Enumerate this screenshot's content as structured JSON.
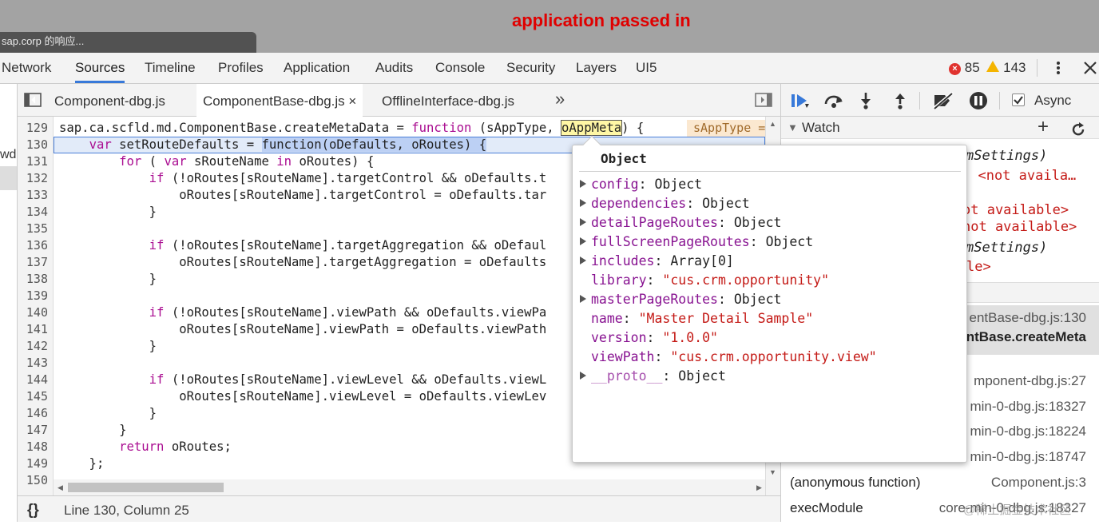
{
  "window": {
    "tab_title": "sap.corp 的响应...",
    "annotation": "application passed in"
  },
  "main_tabs": [
    "Network",
    "Sources",
    "Timeline",
    "Profiles",
    "Application",
    "Audits",
    "Console",
    "Security",
    "Layers",
    "UI5"
  ],
  "main_tab_active": "Sources",
  "counts": {
    "errors": "85",
    "warnings": "143"
  },
  "left_strip_text": "wd",
  "file_tabs": [
    "Component-dbg.js",
    "ComponentBase-dbg.js",
    "OfflineInterface-dbg.js"
  ],
  "file_tab_active": "ComponentBase-dbg.js",
  "more_tabs": "»",
  "code": {
    "line_numbers": [
      "129",
      "130",
      "131",
      "132",
      "133",
      "134",
      "135",
      "136",
      "137",
      "138",
      "139",
      "140",
      "141",
      "142",
      "143",
      "144",
      "145",
      "146",
      "147",
      "148",
      "149",
      "150"
    ],
    "line129": {
      "a": "sap.ca.scfld.md.ComponentBase.createMetaData = ",
      "kw": "function",
      "b": " (sAppType, ",
      "hl": "oAppMeta",
      "c": ") {",
      "hint": "sAppType ="
    },
    "lines": [
      {
        "pre": "    ",
        "kw": "var",
        "post": " setRouteDefaults = "
      },
      {
        "pre": "        ",
        "kw": "for",
        "post": " ( ",
        "kw2": "var",
        "post2": " sRouteName ",
        "kw3": "in",
        "post3": " oRoutes) {"
      },
      {
        "pre": "            ",
        "kw": "if",
        "post": " (!oRoutes[sRouteName].targetControl && oDefaults.t"
      },
      {
        "pre": "                oRoutes[sRouteName].targetControl = oDefaults.tar",
        "kw": "",
        "post": ""
      },
      {
        "pre": "            }",
        "kw": "",
        "post": ""
      },
      {
        "pre": "",
        "kw": "",
        "post": ""
      },
      {
        "pre": "            ",
        "kw": "if",
        "post": " (!oRoutes[sRouteName].targetAggregation && oDefaul"
      },
      {
        "pre": "                oRoutes[sRouteName].targetAggregation = oDefaults",
        "kw": "",
        "post": ""
      },
      {
        "pre": "            }",
        "kw": "",
        "post": ""
      },
      {
        "pre": "",
        "kw": "",
        "post": ""
      },
      {
        "pre": "            ",
        "kw": "if",
        "post": " (!oRoutes[sRouteName].viewPath && oDefaults.viewPa"
      },
      {
        "pre": "                oRoutes[sRouteName].viewPath = oDefaults.viewPath",
        "kw": "",
        "post": ""
      },
      {
        "pre": "            }",
        "kw": "",
        "post": ""
      },
      {
        "pre": "",
        "kw": "",
        "post": ""
      },
      {
        "pre": "            ",
        "kw": "if",
        "post": " (!oRoutes[sRouteName].viewLevel && oDefaults.viewL"
      },
      {
        "pre": "                oRoutes[sRouteName].viewLevel = oDefaults.viewLev",
        "kw": "",
        "post": ""
      },
      {
        "pre": "            }",
        "kw": "",
        "post": ""
      },
      {
        "pre": "        }",
        "kw": "",
        "post": ""
      },
      {
        "pre": "        ",
        "kw": "return",
        "post": " oRoutes;"
      },
      {
        "pre": "    };",
        "kw": "",
        "post": ""
      },
      {
        "pre": "",
        "kw": "",
        "post": ""
      }
    ],
    "line130_fn": "function(oDefaults, oRoutes) {"
  },
  "status_bar": {
    "braces": "{}",
    "position": "Line 130, Column 25"
  },
  "debugger": {
    "async_label": "Async",
    "watch_label": "Watch"
  },
  "right_fragments": [
    {
      "text": "mSettings)",
      "color": "#222",
      "italic": true,
      "mono": true
    },
    {
      "text": "; <not availa…",
      "color": "#c41a16",
      "italic": false,
      "mono": true
    },
    {
      "text": "ot available>",
      "color": "#c41a16",
      "italic": false,
      "mono": true
    },
    {
      "text": "not available>",
      "color": "#c41a16",
      "italic": false,
      "mono": true
    },
    {
      "text": "mSettings)",
      "color": "#222",
      "italic": true,
      "mono": true
    },
    {
      "text": "le>",
      "color": "#c41a16",
      "italic": false,
      "mono": true
    }
  ],
  "call_stack": [
    {
      "name": "",
      "file": "entBase-dbg.js:130"
    },
    {
      "name": "",
      "file": "ntBase.createMeta"
    },
    {
      "name": "",
      "file": "mponent-dbg.js:27"
    },
    {
      "name": "",
      "file": "min-0-dbg.js:18327"
    },
    {
      "name": "",
      "file": "min-0-dbg.js:18224"
    },
    {
      "name": "",
      "file": "min-0-dbg.js:18747"
    },
    {
      "name": "(anonymous function)",
      "file": "Component.js:3"
    },
    {
      "name": "execModule",
      "file": "core-min-0-dbg.js:18327"
    }
  ],
  "watermark": "@稀土掘金技术社区",
  "popup": {
    "title": "Object",
    "props": [
      {
        "key": "config",
        "sep": ": ",
        "val": "Object",
        "str": false,
        "exp": true
      },
      {
        "key": "dependencies",
        "sep": ": ",
        "val": "Object",
        "str": false,
        "exp": true
      },
      {
        "key": "detailPageRoutes",
        "sep": ": ",
        "val": "Object",
        "str": false,
        "exp": true
      },
      {
        "key": "fullScreenPageRoutes",
        "sep": ": ",
        "val": "Object",
        "str": false,
        "exp": true
      },
      {
        "key": "includes",
        "sep": ": ",
        "val": "Array[0]",
        "str": false,
        "exp": true
      },
      {
        "key": "library",
        "sep": ": ",
        "val": "\"cus.crm.opportunity\"",
        "str": true,
        "exp": false
      },
      {
        "key": "masterPageRoutes",
        "sep": ": ",
        "val": "Object",
        "str": false,
        "exp": true
      },
      {
        "key": "name",
        "sep": ": ",
        "val": "\"Master Detail Sample\"",
        "str": true,
        "exp": false
      },
      {
        "key": "version",
        "sep": ": ",
        "val": "\"1.0.0\"",
        "str": true,
        "exp": false
      },
      {
        "key": "viewPath",
        "sep": ": ",
        "val": "\"cus.crm.opportunity.view\"",
        "str": true,
        "exp": false
      },
      {
        "key": "__proto__",
        "sep": ": ",
        "val": "Object",
        "str": false,
        "exp": true
      }
    ]
  }
}
